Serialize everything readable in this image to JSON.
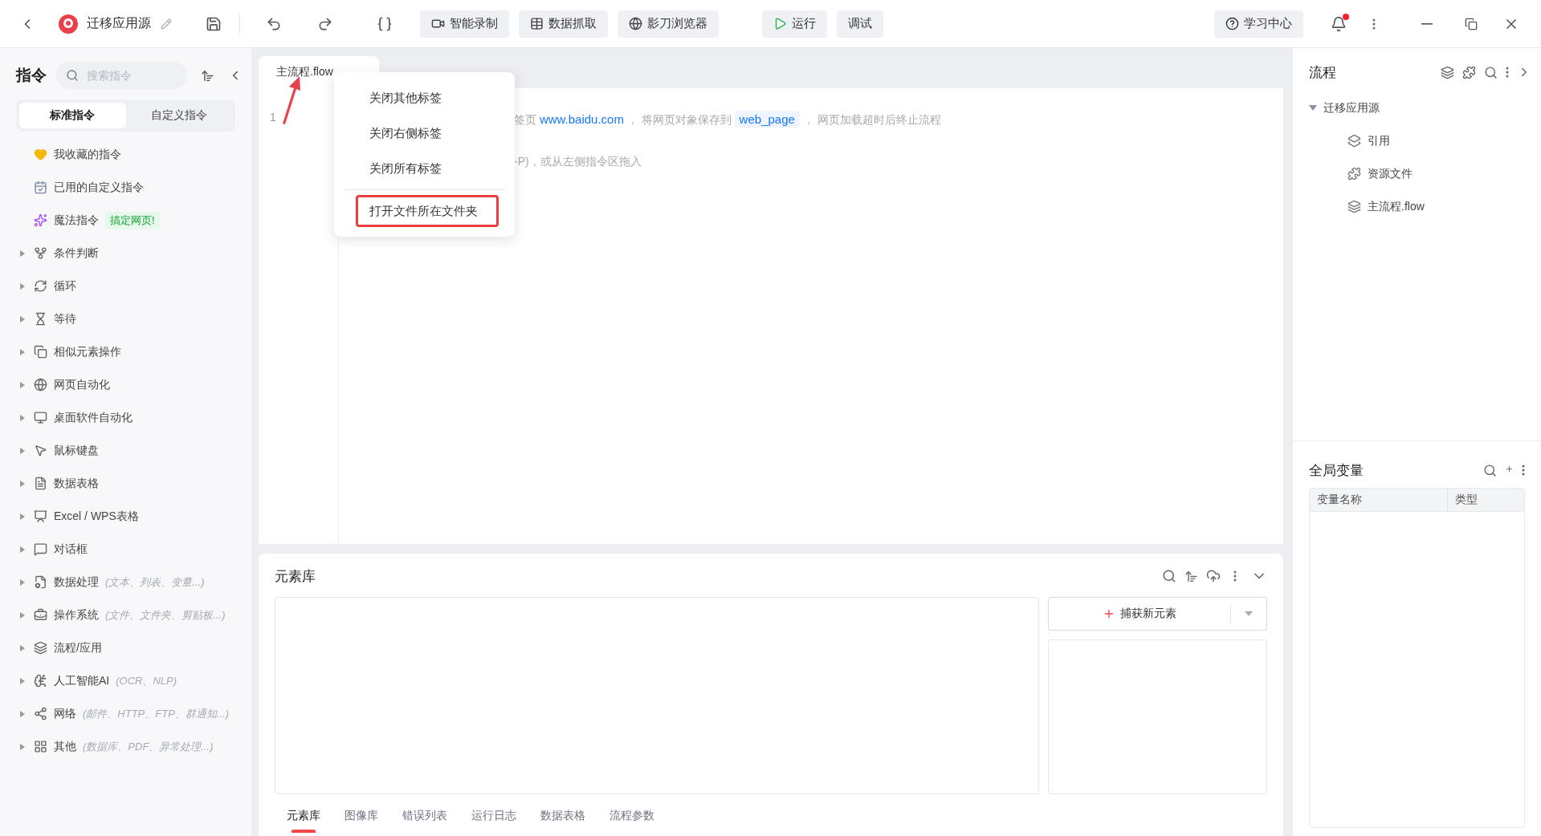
{
  "toolbar": {
    "title": "迁移应用源",
    "buttons": [
      {
        "label": "智能录制",
        "kind": "record"
      },
      {
        "label": "数据抓取",
        "kind": "table"
      },
      {
        "label": "影刀浏览器",
        "kind": "browser"
      },
      {
        "label": "运行",
        "kind": "run"
      },
      {
        "label": "调试",
        "kind": "plain"
      }
    ],
    "help": "学习中心",
    "has_notification": true
  },
  "sidebar": {
    "title": "指令",
    "search_placeholder": "搜索指令",
    "tabs": [
      {
        "label": "标准指令",
        "selected": true
      },
      {
        "label": "自定义指令",
        "selected": false
      }
    ],
    "items": [
      {
        "label": "我收藏的指令",
        "expandable": false
      },
      {
        "label": "已用的自定义指令",
        "expandable": false
      },
      {
        "label": "魔法指令",
        "badge": "搞定网页!",
        "expandable": false
      },
      {
        "label": "条件判断",
        "expandable": true
      },
      {
        "label": "循环",
        "expandable": true
      },
      {
        "label": "等待",
        "expandable": true
      },
      {
        "label": "相似元素操作",
        "expandable": true
      },
      {
        "label": "网页自动化",
        "expandable": true
      },
      {
        "label": "桌面软件自动化",
        "expandable": true
      },
      {
        "label": "鼠标键盘",
        "expandable": true
      },
      {
        "label": "数据表格",
        "expandable": true
      },
      {
        "label": "Excel / WPS表格",
        "expandable": true
      },
      {
        "label": "对话框",
        "expandable": true
      },
      {
        "label": "数据处理",
        "hint": "(文本、列表、变量...)",
        "expandable": true
      },
      {
        "label": "操作系统",
        "hint": "(文件、文件夹、剪贴板...)",
        "expandable": true
      },
      {
        "label": "流程/应用",
        "expandable": true
      },
      {
        "label": "人工智能AI",
        "hint": "(OCR、NLP)",
        "expandable": true
      },
      {
        "label": "网络",
        "hint": "(邮件、HTTP、FTP、群通知...)",
        "expandable": true
      },
      {
        "label": "其他",
        "hint": "(数据库、PDF、异常处理...)",
        "expandable": true
      }
    ]
  },
  "editor": {
    "tabs": [
      {
        "label": "主流程.flow",
        "selected": true
      }
    ],
    "line_number": "1",
    "hint_line_1": {
      "before": "签页",
      "link": "www.baidu.com",
      "middle": "， 将网页对象保存到",
      "variable": "web_page",
      "after": "， 网页加载超时后终止流程"
    },
    "hint_line_2": "-P)，或从左侧指令区拖入"
  },
  "context_menu": {
    "groups": [
      [
        {
          "label": "关闭其他标签",
          "highlighted": false
        },
        {
          "label": "关闭右侧标签",
          "highlighted": false
        },
        {
          "label": "关闭所有标签",
          "highlighted": false
        }
      ],
      [
        {
          "label": "打开文件所在文件夹",
          "highlighted": true
        }
      ]
    ]
  },
  "element_panel": {
    "title": "元素库",
    "capture_button": "捕获新元素",
    "tabs": [
      {
        "label": "元素库",
        "selected": true
      },
      {
        "label": "图像库",
        "selected": false
      },
      {
        "label": "错误列表",
        "selected": false
      },
      {
        "label": "运行日志",
        "selected": false
      },
      {
        "label": "数据表格",
        "selected": false
      },
      {
        "label": "流程参数",
        "selected": false
      }
    ]
  },
  "flow_panel": {
    "title": "流程",
    "tree": [
      {
        "label": "迁移应用源",
        "expanded": true,
        "children": [
          {
            "label": "引用"
          },
          {
            "label": "资源文件"
          },
          {
            "label": "主流程.flow"
          }
        ]
      }
    ]
  },
  "variables_panel": {
    "title": "全局变量",
    "columns": [
      "变量名称",
      "类型"
    ]
  }
}
